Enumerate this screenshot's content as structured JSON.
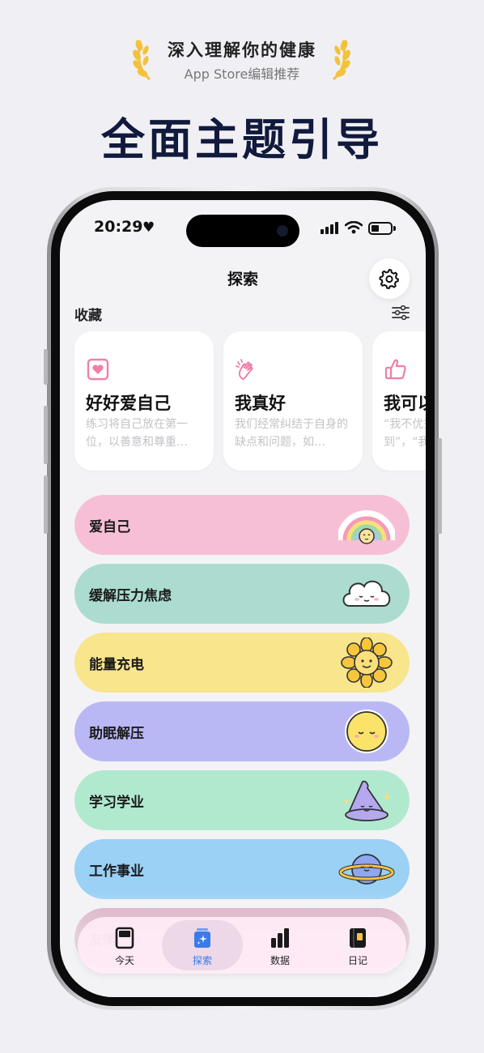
{
  "banner": {
    "award_title": "深入理解你的健康",
    "award_subtitle": "App Store编辑推荐",
    "headline": "全面主题引导"
  },
  "status_bar": {
    "time": "20:29",
    "heart": "♥"
  },
  "nav": {
    "title": "探索"
  },
  "favorites": {
    "title": "收藏",
    "cards": [
      {
        "title": "好好爱自己",
        "desc": "练习将自己放在第一位，以善意和尊重…",
        "icon": "heart-square-icon",
        "color": "#f07fa8"
      },
      {
        "title": "我真好",
        "desc": "我们经常纠结于自身的缺点和问题，如…",
        "icon": "clapping-hands-icon",
        "color": "#f07fa8"
      },
      {
        "title": "我可以",
        "desc": "“我不优秀”“我做不到”，“我…",
        "icon": "thumbs-up-icon",
        "color": "#f07fa8"
      }
    ]
  },
  "topics": [
    {
      "label": "爱自己",
      "color": "#f7bfd6",
      "art": "rainbow-icon"
    },
    {
      "label": "缓解压力焦虑",
      "color": "#abdccf",
      "art": "cloud-icon"
    },
    {
      "label": "能量充电",
      "color": "#f8e58c",
      "art": "sunflower-icon"
    },
    {
      "label": "助眠解压",
      "color": "#b9b8f5",
      "art": "moon-face-icon"
    },
    {
      "label": "学习学业",
      "color": "#b1e9cf",
      "art": "wizard-hat-icon"
    },
    {
      "label": "工作事业",
      "color": "#9ad1f5",
      "art": "planet-icon"
    },
    {
      "label": "友情",
      "color": "#d9a8be",
      "art": "hidden"
    }
  ],
  "tabbar": {
    "tabs": [
      {
        "label": "今天",
        "active": false
      },
      {
        "label": "探索",
        "active": true
      },
      {
        "label": "数据",
        "active": false
      },
      {
        "label": "日记",
        "active": false
      }
    ],
    "active_color": "#3a7bea"
  },
  "colors": {
    "headline": "#111a3c",
    "laurel": "#f2c23a",
    "background": "#f0f0f4"
  }
}
